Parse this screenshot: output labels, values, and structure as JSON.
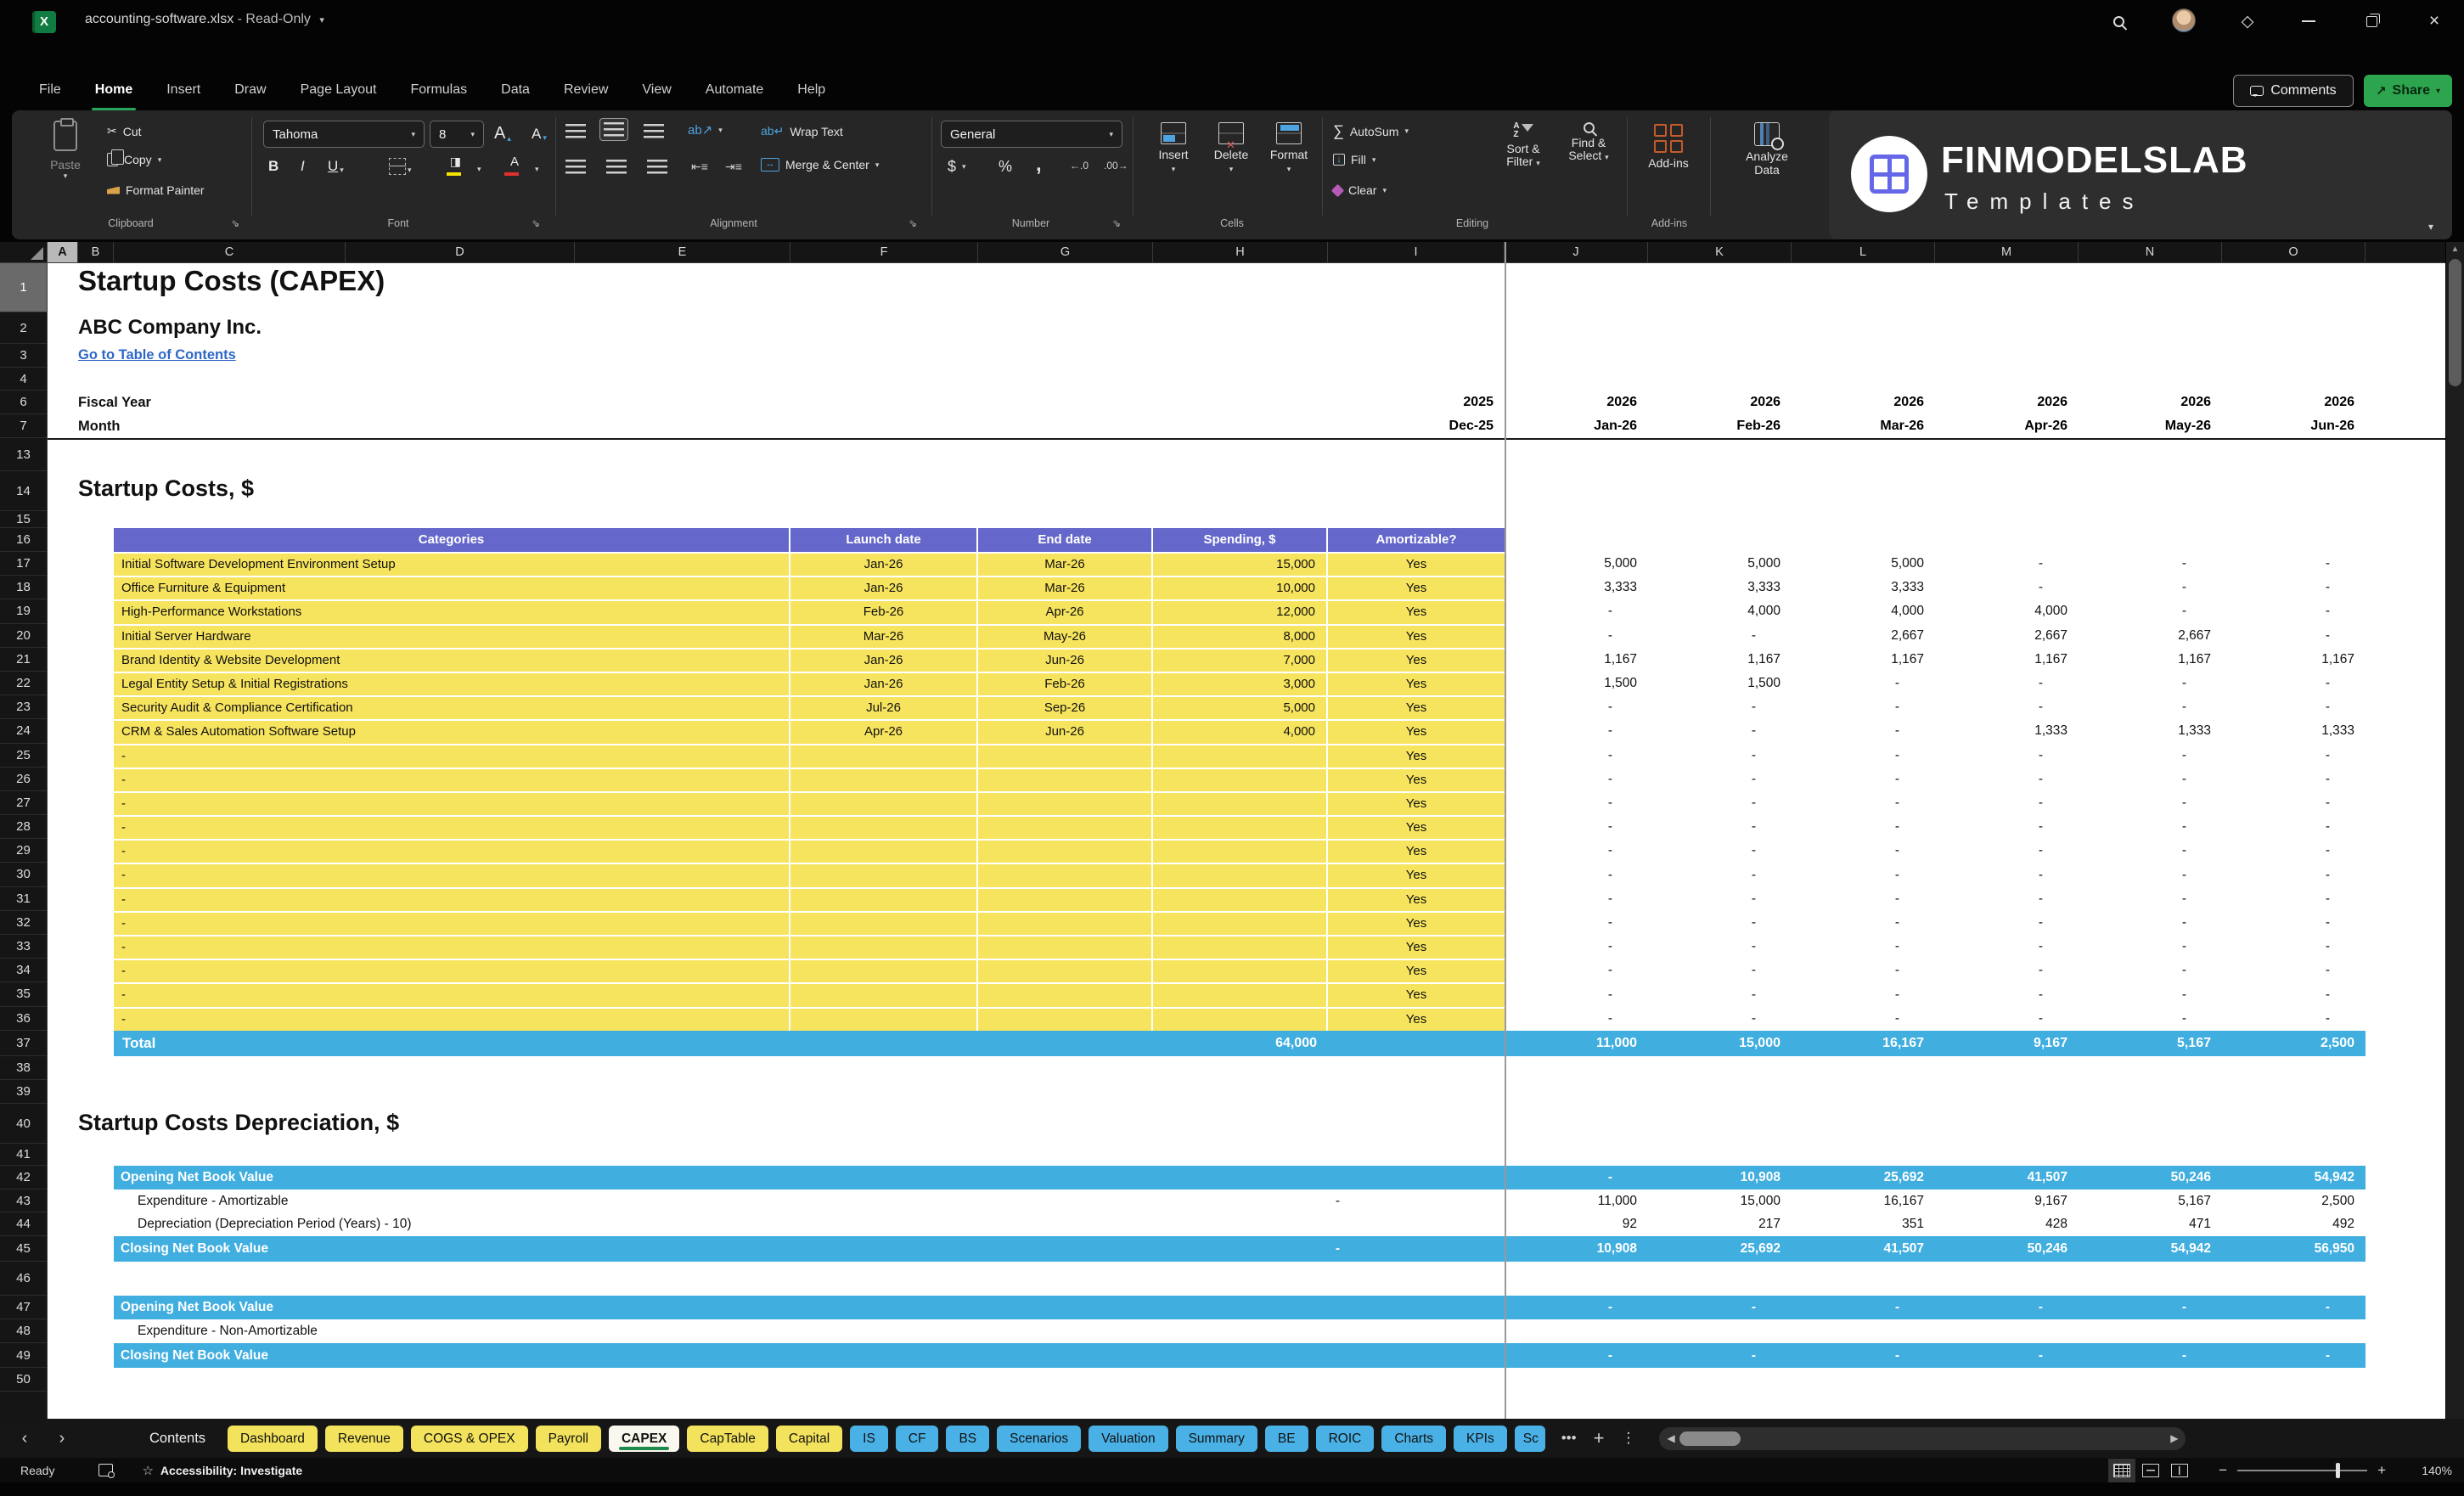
{
  "title_bar": {
    "file_name": "accounting-software.xlsx",
    "dash": "-",
    "mode": "Read-Only"
  },
  "menu": {
    "active": "Home",
    "tabs": [
      "File",
      "Home",
      "Insert",
      "Draw",
      "Page Layout",
      "Formulas",
      "Data",
      "Review",
      "View",
      "Automate",
      "Help"
    ]
  },
  "header_buttons": {
    "comments": "Comments",
    "share": "Share"
  },
  "brand": {
    "line1": "FINMODELSLAB",
    "line2": "Templates"
  },
  "ribbon": {
    "clipboard": {
      "group": "Clipboard",
      "paste": "Paste",
      "cut": "Cut",
      "copy": "Copy",
      "format_painter": "Format Painter"
    },
    "font": {
      "group": "Font",
      "font_name": "Tahoma",
      "font_size": "8"
    },
    "alignment": {
      "group": "Alignment",
      "wrap_text": "Wrap Text",
      "merge_center": "Merge & Center"
    },
    "number": {
      "group": "Number",
      "format": "General"
    },
    "cells": {
      "group": "Cells",
      "insert": "Insert",
      "delete": "Delete",
      "format": "Format"
    },
    "editing": {
      "group": "Editing",
      "autosum": "AutoSum",
      "fill": "Fill",
      "clear": "Clear",
      "sort1": "Sort &",
      "sort2": "Filter",
      "find1": "Find &",
      "find2": "Select"
    },
    "addins": {
      "group": "Add-ins",
      "label": "Add-ins"
    },
    "analyze": {
      "line1": "Analyze",
      "line2": "Data"
    }
  },
  "grid": {
    "columns": [
      [
        "A",
        36
      ],
      [
        "B",
        42
      ],
      [
        "C",
        273
      ],
      [
        "D",
        270
      ],
      [
        "E",
        254
      ],
      [
        "F",
        221
      ],
      [
        "G",
        206
      ],
      [
        "H",
        206
      ],
      [
        "I",
        208
      ],
      [
        "J",
        169
      ],
      [
        "K",
        169
      ],
      [
        "L",
        169
      ],
      [
        "M",
        169
      ],
      [
        "N",
        169
      ],
      [
        "O",
        169
      ]
    ],
    "row_numbers": [
      [
        "1",
        58
      ],
      [
        "2",
        37
      ],
      [
        "3",
        28
      ],
      [
        "4",
        27
      ],
      [
        "6",
        28
      ],
      [
        "7",
        28
      ],
      [
        "13",
        39
      ],
      [
        "14",
        47
      ],
      [
        "15",
        20
      ],
      [
        "16",
        28
      ],
      [
        "17",
        28.2
      ],
      [
        "18",
        28.2
      ],
      [
        "19",
        28.2
      ],
      [
        "20",
        28.2
      ],
      [
        "21",
        28.2
      ],
      [
        "22",
        28.2
      ],
      [
        "23",
        28.2
      ],
      [
        "24",
        28.2
      ],
      [
        "25",
        28.2
      ],
      [
        "26",
        28.2
      ],
      [
        "27",
        28.2
      ],
      [
        "28",
        28.2
      ],
      [
        "29",
        28.2
      ],
      [
        "30",
        28.2
      ],
      [
        "31",
        28.2
      ],
      [
        "32",
        28.2
      ],
      [
        "33",
        28.2
      ],
      [
        "34",
        28.2
      ],
      [
        "35",
        28.2
      ],
      [
        "36",
        28.2
      ],
      [
        "37",
        30
      ],
      [
        "38",
        28
      ],
      [
        "39",
        28
      ],
      [
        "40",
        47
      ],
      [
        "41",
        26
      ],
      [
        "42",
        28
      ],
      [
        "43",
        27
      ],
      [
        "44",
        28
      ],
      [
        "45",
        30
      ],
      [
        "46",
        40
      ],
      [
        "47",
        28
      ],
      [
        "48",
        28
      ],
      [
        "49",
        29
      ],
      [
        "50",
        28
      ]
    ]
  },
  "sheet": {
    "doc_title": "Startup Costs (CAPEX)",
    "company": "ABC Company Inc.",
    "link": "Go to Table of Contents",
    "fiscal_year_label": "Fiscal Year",
    "month_label": "Month",
    "years": [
      "2025",
      "2026",
      "2026",
      "2026",
      "2026",
      "2026",
      "2026"
    ],
    "months": [
      "Dec-25",
      "Jan-26",
      "Feb-26",
      "Mar-26",
      "Apr-26",
      "May-26",
      "Jun-26"
    ],
    "section1_title": "Startup Costs, $",
    "table_headers": [
      "Categories",
      "Launch date",
      "End date",
      "Spending, $",
      "Amortizable?"
    ],
    "items": [
      {
        "category": "Initial Software Development Environment Setup",
        "launch": "Jan-26",
        "end": "Mar-26",
        "spending": "15,000",
        "amortizable": "Yes",
        "monthly": [
          "5,000",
          "5,000",
          "5,000",
          "-",
          "-",
          "-"
        ]
      },
      {
        "category": "Office Furniture & Equipment",
        "launch": "Jan-26",
        "end": "Mar-26",
        "spending": "10,000",
        "amortizable": "Yes",
        "monthly": [
          "3,333",
          "3,333",
          "3,333",
          "-",
          "-",
          "-"
        ]
      },
      {
        "category": "High-Performance Workstations",
        "launch": "Feb-26",
        "end": "Apr-26",
        "spending": "12,000",
        "amortizable": "Yes",
        "monthly": [
          "-",
          "4,000",
          "4,000",
          "4,000",
          "-",
          "-"
        ]
      },
      {
        "category": "Initial Server Hardware",
        "launch": "Mar-26",
        "end": "May-26",
        "spending": "8,000",
        "amortizable": "Yes",
        "monthly": [
          "-",
          "-",
          "2,667",
          "2,667",
          "2,667",
          "-"
        ]
      },
      {
        "category": "Brand Identity & Website Development",
        "launch": "Jan-26",
        "end": "Jun-26",
        "spending": "7,000",
        "amortizable": "Yes",
        "monthly": [
          "1,167",
          "1,167",
          "1,167",
          "1,167",
          "1,167",
          "1,167"
        ]
      },
      {
        "category": "Legal Entity Setup & Initial Registrations",
        "launch": "Jan-26",
        "end": "Feb-26",
        "spending": "3,000",
        "amortizable": "Yes",
        "monthly": [
          "1,500",
          "1,500",
          "-",
          "-",
          "-",
          "-"
        ]
      },
      {
        "category": "Security Audit & Compliance Certification",
        "launch": "Jul-26",
        "end": "Sep-26",
        "spending": "5,000",
        "amortizable": "Yes",
        "monthly": [
          "-",
          "-",
          "-",
          "-",
          "-",
          "-"
        ]
      },
      {
        "category": "CRM & Sales Automation Software Setup",
        "launch": "Apr-26",
        "end": "Jun-26",
        "spending": "4,000",
        "amortizable": "Yes",
        "monthly": [
          "-",
          "-",
          "-",
          "1,333",
          "1,333",
          "1,333"
        ]
      },
      {
        "category": "-",
        "launch": "",
        "end": "",
        "spending": "",
        "amortizable": "Yes",
        "monthly": [
          "-",
          "-",
          "-",
          "-",
          "-",
          "-"
        ]
      },
      {
        "category": "-",
        "launch": "",
        "end": "",
        "spending": "",
        "amortizable": "Yes",
        "monthly": [
          "-",
          "-",
          "-",
          "-",
          "-",
          "-"
        ]
      },
      {
        "category": "-",
        "launch": "",
        "end": "",
        "spending": "",
        "amortizable": "Yes",
        "monthly": [
          "-",
          "-",
          "-",
          "-",
          "-",
          "-"
        ]
      },
      {
        "category": "-",
        "launch": "",
        "end": "",
        "spending": "",
        "amortizable": "Yes",
        "monthly": [
          "-",
          "-",
          "-",
          "-",
          "-",
          "-"
        ]
      },
      {
        "category": "-",
        "launch": "",
        "end": "",
        "spending": "",
        "amortizable": "Yes",
        "monthly": [
          "-",
          "-",
          "-",
          "-",
          "-",
          "-"
        ]
      },
      {
        "category": "-",
        "launch": "",
        "end": "",
        "spending": "",
        "amortizable": "Yes",
        "monthly": [
          "-",
          "-",
          "-",
          "-",
          "-",
          "-"
        ]
      },
      {
        "category": "-",
        "launch": "",
        "end": "",
        "spending": "",
        "amortizable": "Yes",
        "monthly": [
          "-",
          "-",
          "-",
          "-",
          "-",
          "-"
        ]
      },
      {
        "category": "-",
        "launch": "",
        "end": "",
        "spending": "",
        "amortizable": "Yes",
        "monthly": [
          "-",
          "-",
          "-",
          "-",
          "-",
          "-"
        ]
      },
      {
        "category": "-",
        "launch": "",
        "end": "",
        "spending": "",
        "amortizable": "Yes",
        "monthly": [
          "-",
          "-",
          "-",
          "-",
          "-",
          "-"
        ]
      },
      {
        "category": "-",
        "launch": "",
        "end": "",
        "spending": "",
        "amortizable": "Yes",
        "monthly": [
          "-",
          "-",
          "-",
          "-",
          "-",
          "-"
        ]
      },
      {
        "category": "-",
        "launch": "",
        "end": "",
        "spending": "",
        "amortizable": "Yes",
        "monthly": [
          "-",
          "-",
          "-",
          "-",
          "-",
          "-"
        ]
      },
      {
        "category": "-",
        "launch": "",
        "end": "",
        "spending": "",
        "amortizable": "Yes",
        "monthly": [
          "-",
          "-",
          "-",
          "-",
          "-",
          "-"
        ]
      }
    ],
    "total": {
      "label": "Total",
      "spending": "64,000",
      "monthly": [
        "11,000",
        "15,000",
        "16,167",
        "9,167",
        "5,167",
        "2,500"
      ]
    },
    "section2_title": "Startup Costs Depreciation, $",
    "dep_rows": [
      {
        "label": "Opening Net Book Value",
        "style": "blue",
        "dec": "",
        "monthly": [
          "-",
          "10,908",
          "25,692",
          "41,507",
          "50,246",
          "54,942"
        ]
      },
      {
        "label": "Expenditure - Amortizable",
        "style": "plain",
        "dec": "-",
        "monthly": [
          "11,000",
          "15,000",
          "16,167",
          "9,167",
          "5,167",
          "2,500"
        ]
      },
      {
        "label": "Depreciation (Depreciation Period (Years) - 10)",
        "style": "plain",
        "dec": "",
        "monthly": [
          "92",
          "217",
          "351",
          "428",
          "471",
          "492"
        ]
      },
      {
        "label": "Closing Net Book Value",
        "style": "blue",
        "dec": "-",
        "monthly": [
          "10,908",
          "25,692",
          "41,507",
          "50,246",
          "54,942",
          "56,950"
        ]
      }
    ],
    "dep2_rows": [
      {
        "label": "Opening Net Book Value",
        "style": "blue",
        "dec": "",
        "monthly": [
          "-",
          "-",
          "-",
          "-",
          "-",
          "-"
        ]
      },
      {
        "label": "Expenditure - Non-Amortizable",
        "style": "plain",
        "dec": "",
        "monthly": [
          "",
          "",
          "",
          "",
          "",
          ""
        ]
      },
      {
        "label": "Closing Net Book Value",
        "style": "blue",
        "dec": "",
        "monthly": [
          "-",
          "-",
          "-",
          "-",
          "-",
          "-"
        ]
      }
    ]
  },
  "tabs": {
    "items": [
      {
        "label": "Contents",
        "type": "plain"
      },
      {
        "label": "Dashboard",
        "type": "yellow"
      },
      {
        "label": "Revenue",
        "type": "yellow"
      },
      {
        "label": "COGS & OPEX",
        "type": "yellow"
      },
      {
        "label": "Payroll",
        "type": "yellow"
      },
      {
        "label": "CAPEX",
        "type": "active"
      },
      {
        "label": "CapTable",
        "type": "yellow"
      },
      {
        "label": "Capital",
        "type": "yellow"
      },
      {
        "label": "IS",
        "type": "blue"
      },
      {
        "label": "CF",
        "type": "blue"
      },
      {
        "label": "BS",
        "type": "blue"
      },
      {
        "label": "Scenarios",
        "type": "blue"
      },
      {
        "label": "Valuation",
        "type": "blue"
      },
      {
        "label": "Summary",
        "type": "blue"
      },
      {
        "label": "BE",
        "type": "blue"
      },
      {
        "label": "ROIC",
        "type": "blue"
      },
      {
        "label": "Charts",
        "type": "blue"
      },
      {
        "label": "KPIs",
        "type": "blue"
      },
      {
        "label": "Sc",
        "type": "blue cut"
      }
    ]
  },
  "status": {
    "ready": "Ready",
    "accessibility": "Accessibility: Investigate",
    "zoom": "140%"
  },
  "colors": {
    "accent_green": "#27a75c",
    "share_green": "#2DA44E",
    "header_purple": "#6567CA",
    "row_yellow": "#F7E45E",
    "total_blue": "#41AEE0",
    "tab_yellow": "#F2E25C",
    "tab_blue": "#4AB1E6",
    "link_blue": "#2d68c8",
    "addins_orange": "#C65B29"
  }
}
